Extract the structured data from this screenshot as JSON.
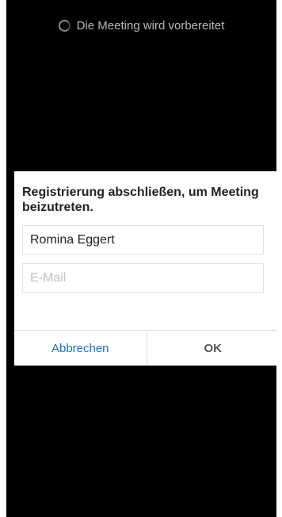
{
  "status": {
    "text": "Die Meeting wird vorbereitet",
    "icon": "loading-spinner-icon"
  },
  "dialog": {
    "title": "Registrierung abschließen, um Meeting beizutreten.",
    "name_field": {
      "value": "Romina Eggert",
      "placeholder": ""
    },
    "email_field": {
      "value": "",
      "placeholder": "E-Mail"
    },
    "cancel_label": "Abbrechen",
    "ok_label": "OK"
  },
  "colors": {
    "background": "#000000",
    "dialog": "#ffffff",
    "accent": "#1e6fcf"
  }
}
